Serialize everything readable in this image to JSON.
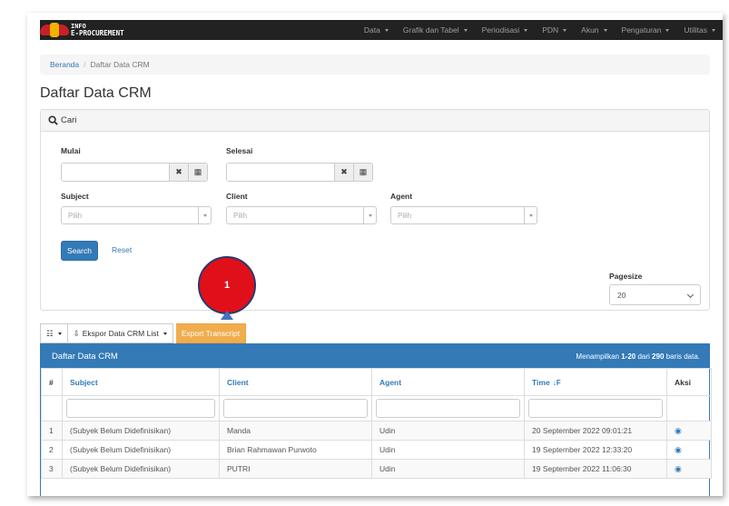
{
  "app": {
    "logo_line1": "INFO",
    "logo_line2": "E-PROCUREMENT",
    "menu": [
      "Data",
      "Grafik dan Tabel",
      "Periodisasi",
      "PDN",
      "Akun",
      "Pengaturan",
      "Utilitas"
    ]
  },
  "breadcrumb": {
    "home": "Beranda",
    "separator": "/",
    "current": "Daftar Data CRM"
  },
  "page_title": "Daftar Data CRM",
  "search_panel": {
    "title": "Cari",
    "mulai_label": "Mulai",
    "selesai_label": "Selesai",
    "subject_label": "Subject",
    "client_label": "Client",
    "agent_label": "Agent",
    "subject_placeholder": "Pilih",
    "client_placeholder": "Pilih",
    "agent_placeholder": "Pilih",
    "clear_symbol": "✖",
    "calendar_symbol": "▦",
    "search_button": "Search",
    "reset_link": "Reset",
    "pagesize_label": "Pagesize",
    "pagesize_value": "20"
  },
  "toolbar": {
    "columns_icon": "☷",
    "export_list_icon": "⇩",
    "export_list_label": "Ekspor Data CRM List",
    "export_transcript": "Export Transcript"
  },
  "annotation": {
    "number": "1"
  },
  "data_panel": {
    "title": "Daftar Data CRM",
    "info_prefix": "Menampilkan",
    "info_range": "1-20",
    "info_mid": "dari",
    "info_total": "290",
    "info_suffix": "baris data.",
    "columns": [
      "#",
      "Subject",
      "Client",
      "Agent",
      "Time",
      "Aksi"
    ],
    "sort_symbol": "↓F",
    "view_symbol": "◉",
    "rows": [
      {
        "no": "1",
        "subject": "(Subyek Belum Didefinisikan)",
        "client": "Manda",
        "agent": "Udin",
        "time": "20 September 2022 09:01:21"
      },
      {
        "no": "2",
        "subject": "(Subyek Belum Didefinisikan)",
        "client": "Brian Rahmawan Purwoto",
        "agent": "Udin",
        "time": "19 September 2022 12:33:20"
      },
      {
        "no": "3",
        "subject": "(Subyek Belum Didefinisikan)",
        "client": "PUTRI",
        "agent": "Udin",
        "time": "19 September 2022 11:06:30"
      }
    ]
  },
  "colors": {
    "primary": "#337ab7",
    "warning": "#f0ad4e",
    "navbar": "#222222",
    "annotation_red": "#e0101a",
    "annotation_arrow": "#4472c4"
  }
}
